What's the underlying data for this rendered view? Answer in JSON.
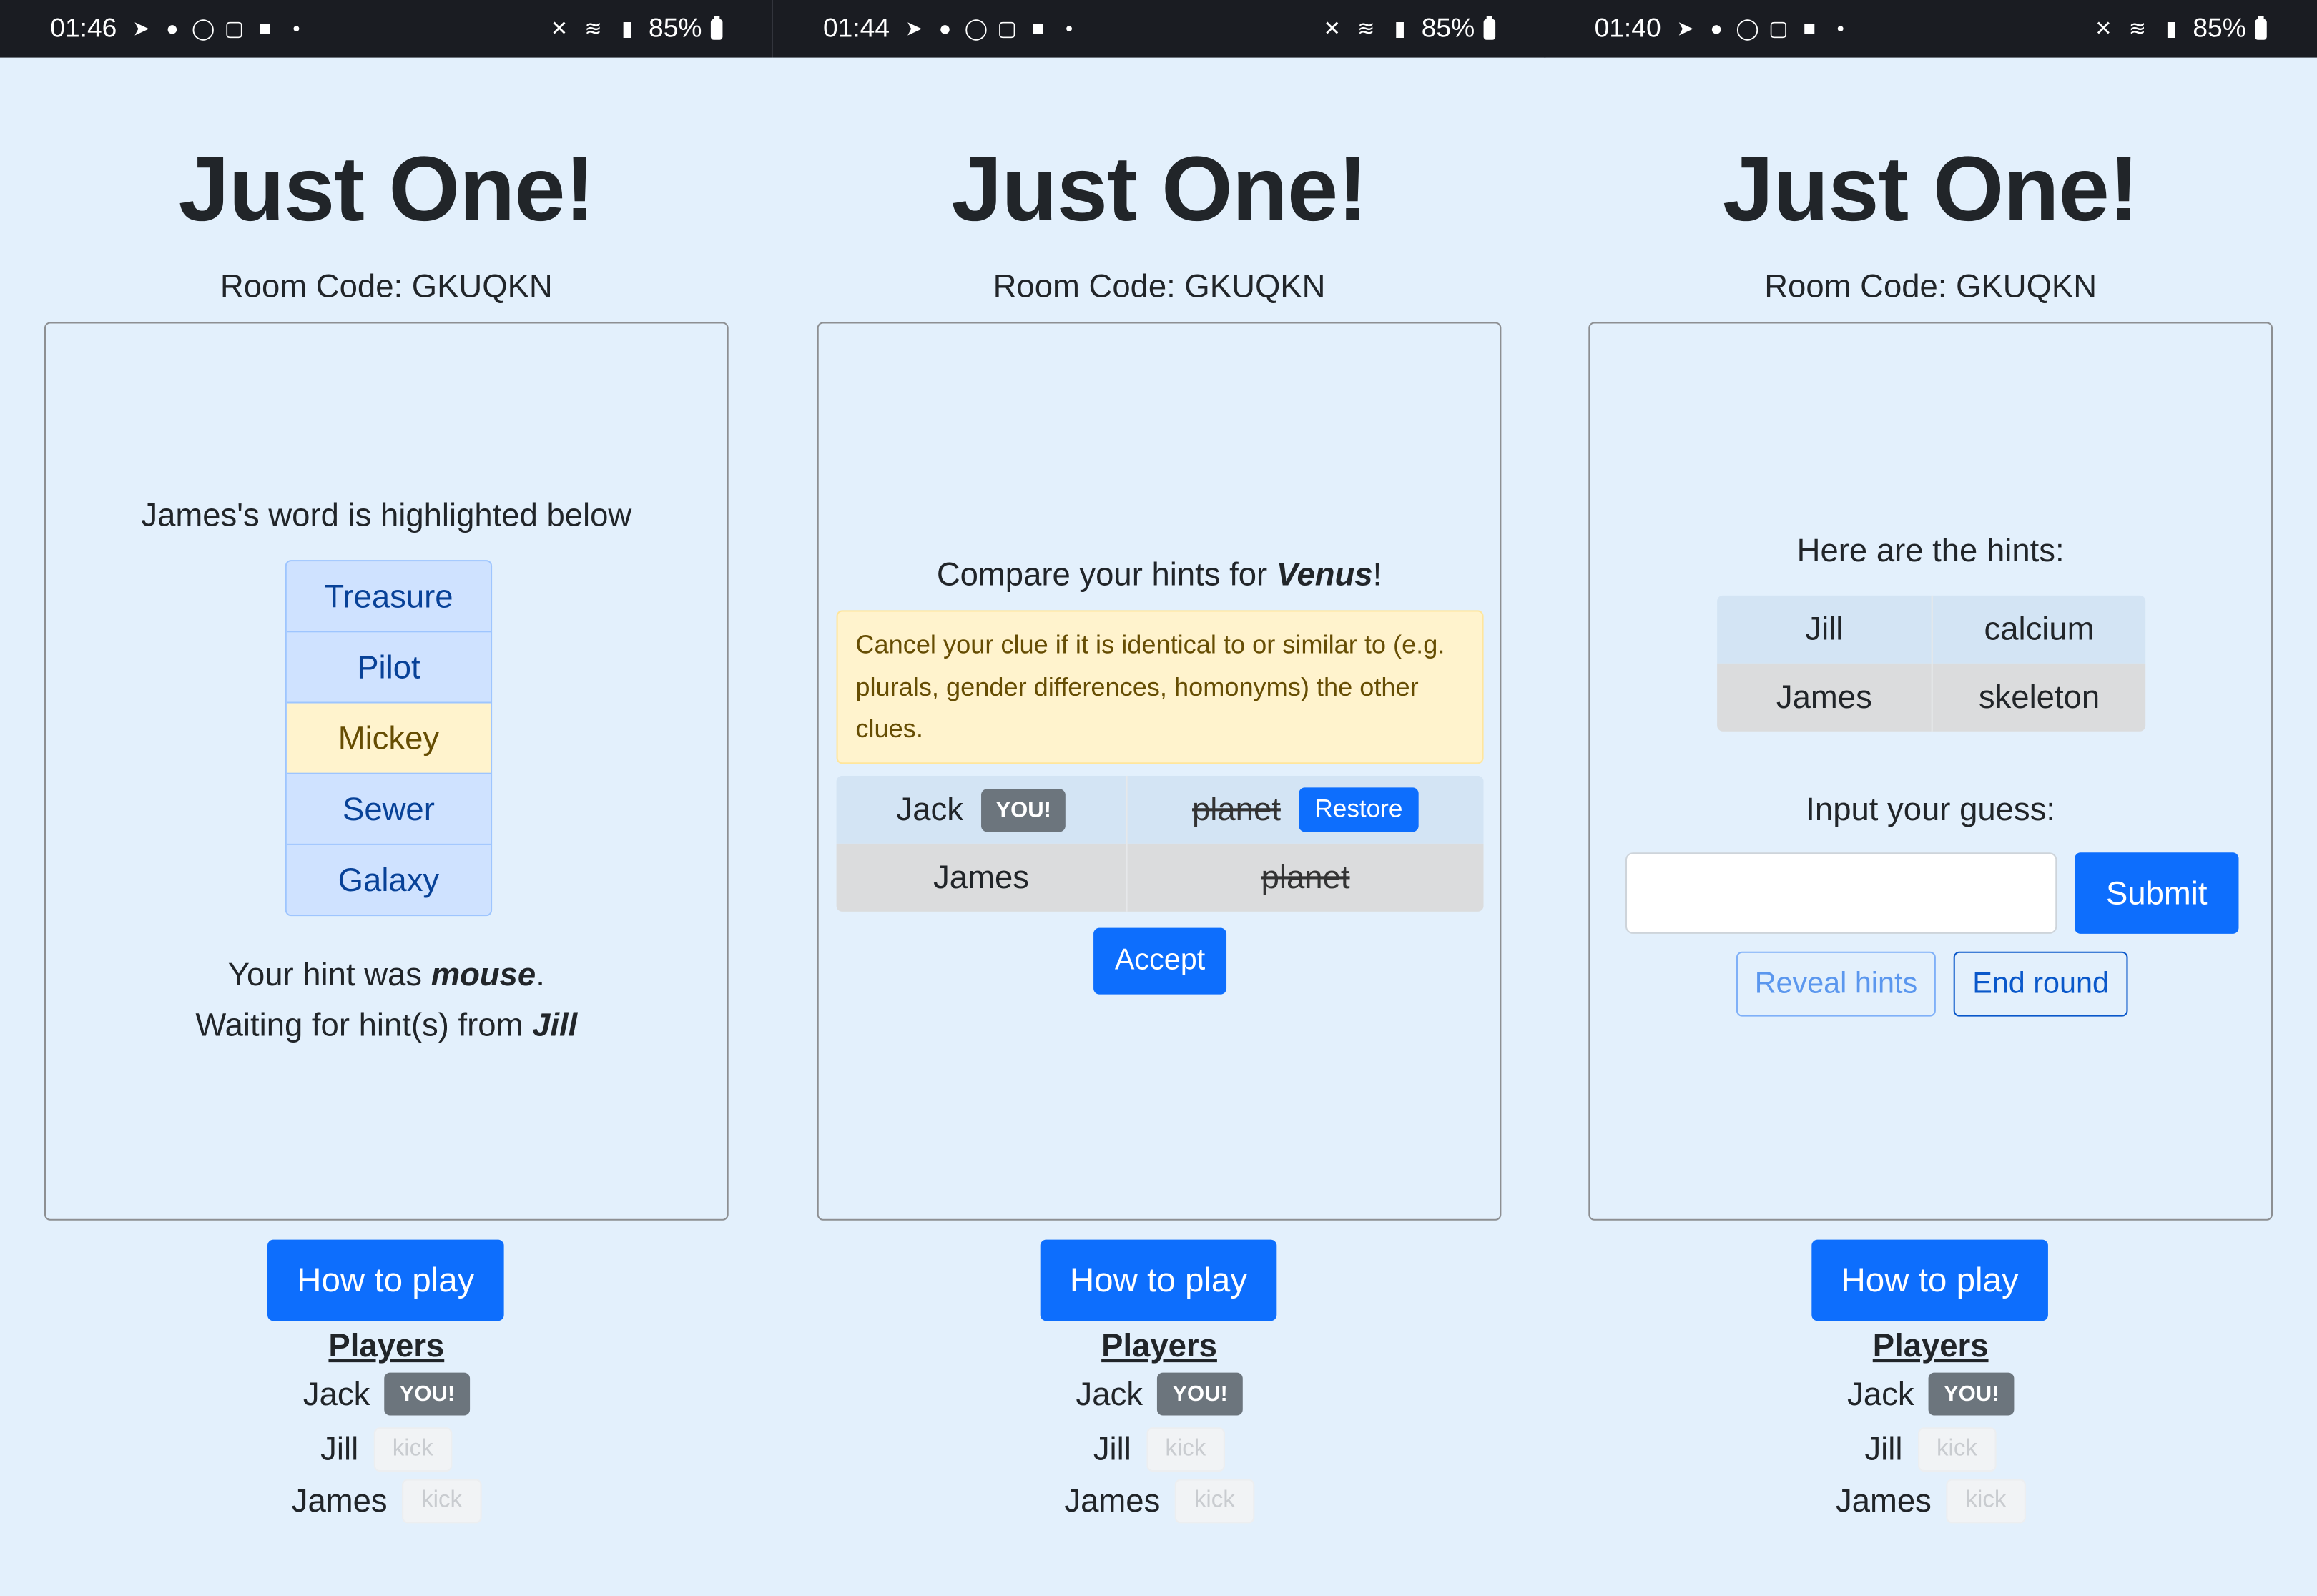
{
  "panels": [
    {
      "status": {
        "time": "01:46",
        "battery": "85%"
      },
      "title": "Just One!",
      "room_code": "Room Code: GKUQKN",
      "heading": "James's word is highlighted below",
      "words": [
        "Treasure",
        "Pilot",
        "Mickey",
        "Sewer",
        "Galaxy"
      ],
      "highlighted_word": "Mickey",
      "hint_prefix": "Your hint was ",
      "hint_word": "mouse",
      "hint_suffix": ".",
      "waiting_prefix": "Waiting for hint(s) from ",
      "waiting_name": "Jill",
      "how_to_play": "How to play",
      "players_label": "Players",
      "players": [
        {
          "name": "Jack",
          "badge": "YOU!"
        },
        {
          "name": "Jill",
          "action": "kick"
        },
        {
          "name": "James",
          "action": "kick"
        }
      ]
    },
    {
      "status": {
        "time": "01:44",
        "battery": "85%"
      },
      "title": "Just One!",
      "room_code": "Room Code: GKUQKN",
      "compare_prefix": "Compare your hints for ",
      "compare_word": "Venus",
      "compare_suffix": "!",
      "alert": "Cancel your clue if it is identical to or similar to (e.g. plurals, gender differences, homonyms) the other clues.",
      "clues": [
        {
          "player": "Jack",
          "badge": "YOU!",
          "clue": "planet",
          "button": "Restore"
        },
        {
          "player": "James",
          "clue": "planet"
        }
      ],
      "accept": "Accept",
      "how_to_play": "How to play",
      "players_label": "Players",
      "players": [
        {
          "name": "Jack",
          "badge": "YOU!"
        },
        {
          "name": "Jill",
          "action": "kick"
        },
        {
          "name": "James",
          "action": "kick"
        }
      ]
    },
    {
      "status": {
        "time": "01:40",
        "battery": "85%"
      },
      "title": "Just One!",
      "room_code": "Room Code: GKUQKN",
      "hints_heading": "Here are the hints:",
      "hints": [
        {
          "player": "Jill",
          "hint": "calcium"
        },
        {
          "player": "James",
          "hint": "skeleton"
        }
      ],
      "guess_label": "Input your guess:",
      "guess_value": "",
      "submit": "Submit",
      "reveal_hints": "Reveal hints",
      "end_round": "End round",
      "how_to_play": "How to play",
      "players_label": "Players",
      "players": [
        {
          "name": "Jack",
          "badge": "YOU!"
        },
        {
          "name": "Jill",
          "action": "kick"
        },
        {
          "name": "James",
          "action": "kick"
        }
      ]
    }
  ]
}
